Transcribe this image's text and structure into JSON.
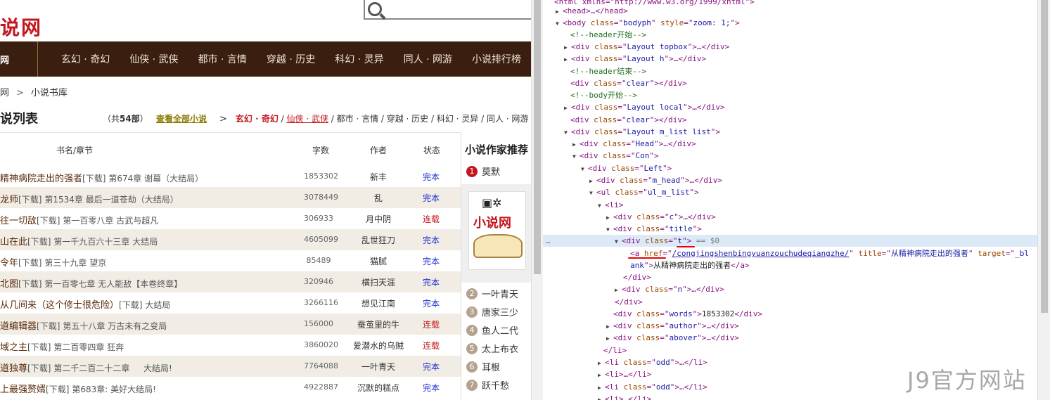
{
  "site": {
    "logo_text": "说网",
    "nav_home": "网",
    "nav": [
      "玄幻 · 奇幻",
      "仙侠 · 武侠",
      "都市 · 言情",
      "穿越 · 历史",
      "科幻 · 灵异",
      "同人 · 网游",
      "小说排行榜"
    ],
    "breadcrumb": {
      "home": "网",
      "sep": ">",
      "current": "小说书库"
    }
  },
  "listing": {
    "title": "说列表",
    "count_prefix": "（共",
    "count_value": "54部",
    "count_suffix": "）",
    "view_all": "查看全部小说",
    "filter_arrow": ">",
    "filter_active": "玄幻 · 奇幻",
    "filter_sep": " / ",
    "filter_linked": "仙侠 · 武侠",
    "filter_rest": " / 都市 · 言情 / 穿越 · 历史 / 科幻 · 灵异 / 同人 · 网游",
    "columns": {
      "title": "书名/章节",
      "words": "字数",
      "author": "作者",
      "status": "状态"
    },
    "rows": [
      {
        "book": "精神病院走出的强者",
        "dl": "[下载]",
        "chapter": "第674章 谢幕（大结局）",
        "words": "1853302",
        "author": "新丰",
        "status": "完本",
        "state": "done"
      },
      {
        "book": "龙师",
        "dl": "[下载]",
        "chapter": "第1534章 最后一道苍劫（大结局）",
        "words": "3078449",
        "author": "乱",
        "status": "完本",
        "state": "done"
      },
      {
        "book": "往一切敌",
        "dl": "[下载]",
        "chapter": "第一百零八章 古武与超凡",
        "words": "306933",
        "author": "月中阴",
        "status": "连载",
        "state": "ongoing"
      },
      {
        "book": "山在此",
        "dl": "[下载]",
        "chapter": "第一千九百六十三章 大结局",
        "words": "4605099",
        "author": "乱世狂刀",
        "status": "完本",
        "state": "done"
      },
      {
        "book": "令年",
        "dl": "[下载]",
        "chapter": "第三十九章 望京",
        "words": "85489",
        "author": "猫腻",
        "status": "完本",
        "state": "done"
      },
      {
        "book": "北图",
        "dl": "[下载]",
        "chapter": "第一百零七章 无人能敌【本卷终章】",
        "words": "320946",
        "author": "横扫天涯",
        "status": "完本",
        "state": "done"
      },
      {
        "book": "从几间来（这个修士很危险）",
        "dl": "[下载]",
        "chapter": "大结局",
        "words": "3266116",
        "author": "想见江南",
        "status": "完本",
        "state": "done"
      },
      {
        "book": "道编辑器",
        "dl": "[下载]",
        "chapter": "第五十八章 万古未有之变局",
        "words": "156000",
        "author": "蚕茧里的牛",
        "status": "连载",
        "state": "ongoing"
      },
      {
        "book": "域之主",
        "dl": "[下载]",
        "chapter": "第二百零四章 狂奔",
        "words": "3860020",
        "author": "爱潜水的乌贼",
        "status": "连载",
        "state": "ongoing"
      },
      {
        "book": "道独尊",
        "dl": "[下载]",
        "chapter": "第二千二百二十二章 　 大结局!",
        "words": "7764088",
        "author": "一叶青天",
        "status": "完本",
        "state": "done"
      },
      {
        "book": "上最强赘婿",
        "dl": "[下载]",
        "chapter": "第683章: 美好大结局!",
        "words": "4922887",
        "author": "沉默的糕点",
        "status": "完本",
        "state": "done"
      }
    ]
  },
  "sidebar": {
    "title": "小说作家推荐",
    "first": {
      "num": "1",
      "name": "莫默"
    },
    "banner_text": "小说网",
    "ranks": [
      {
        "num": "2",
        "name": "一叶青天"
      },
      {
        "num": "3",
        "name": "唐家三少"
      },
      {
        "num": "4",
        "name": "鱼人二代"
      },
      {
        "num": "5",
        "name": "太上布衣"
      },
      {
        "num": "6",
        "name": "耳根"
      },
      {
        "num": "7",
        "name": "跃千愁"
      }
    ]
  },
  "devtools": {
    "l0": "<html xmlns=\"http://www.w3.org/1999/xhtml\">",
    "l1": "<head>…</head>",
    "l2_tag": "<body",
    "l2_class": "bodyph",
    "l2_style": "zoom: 1;",
    "c_header_start": "<!--header开始-->",
    "topbox": "Layout topbox",
    "layout_h": "Layout h",
    "c_header_end": "<!--header结束-->",
    "clear": "clear",
    "c_body_start": "<!--body开始-->",
    "local": "Layout local",
    "m_list": "Layout m_list list",
    "head": "Head",
    "con": "Con",
    "left": "Left",
    "m_head": "m_head",
    "ul_m_list": "ul_m_list",
    "li": "<li>",
    "c": "c",
    "title": "title",
    "t": "t",
    "eq0": "== $0",
    "href": "/congjingshenbingyuanzouchudeqiangzhe/",
    "a_title": "从精神病院走出的强者",
    "target_a": "_bl",
    "target_b": "ank",
    "a_text": "从精神病院走出的强者",
    "n": "n",
    "words_val": "1853302",
    "author": "author",
    "abover": "abover",
    "odd": "odd"
  },
  "watermark": "J9官方网站"
}
